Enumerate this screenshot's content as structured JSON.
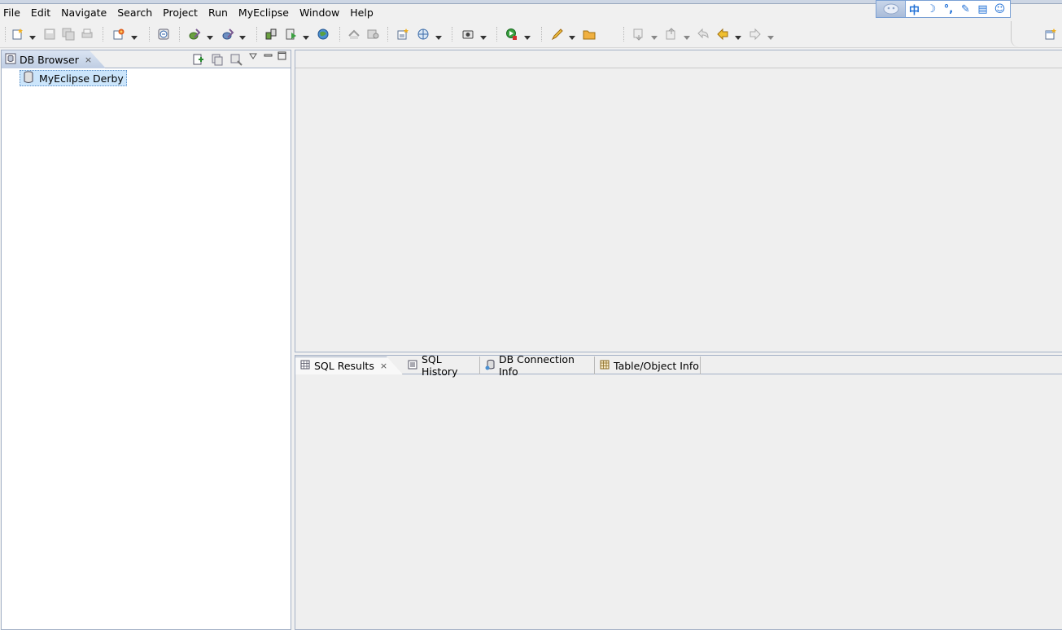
{
  "menu": [
    "File",
    "Edit",
    "Navigate",
    "Search",
    "Project",
    "Run",
    "MyEclipse",
    "Window",
    "Help"
  ],
  "ime": {
    "lang_label": "中",
    "moon_label": "☽",
    "punct_label": "°,",
    "tool_label": "✎",
    "pad_label": "▤",
    "smile_label": "☺"
  },
  "db_browser": {
    "tab_label": "DB Browser",
    "tree_items": [
      "MyEclipse Derby"
    ]
  },
  "bottom_tabs": [
    "SQL Results",
    "SQL History",
    "DB Connection Info",
    "Table/Object Info"
  ],
  "icons": {
    "close": "×",
    "toolbar": [
      "new-icon",
      "save-icon",
      "save-all-icon",
      "print-icon",
      "new-wizard-icon",
      "open-type-icon",
      "debug-icon",
      "run-icon",
      "deploy-icon",
      "server-run-icon",
      "browser-icon",
      "cut-icon",
      "copy-icon",
      "new-java-icon",
      "web-icon",
      "camera-icon",
      "run-last-icon",
      "pencil-icon",
      "folder-icon",
      "next-annotation-icon",
      "prev-annotation-icon",
      "last-edit-icon",
      "back-icon",
      "forward-icon"
    ]
  },
  "colors": {
    "accent": "#a4b1c6",
    "selection": "#cbe5fb"
  }
}
